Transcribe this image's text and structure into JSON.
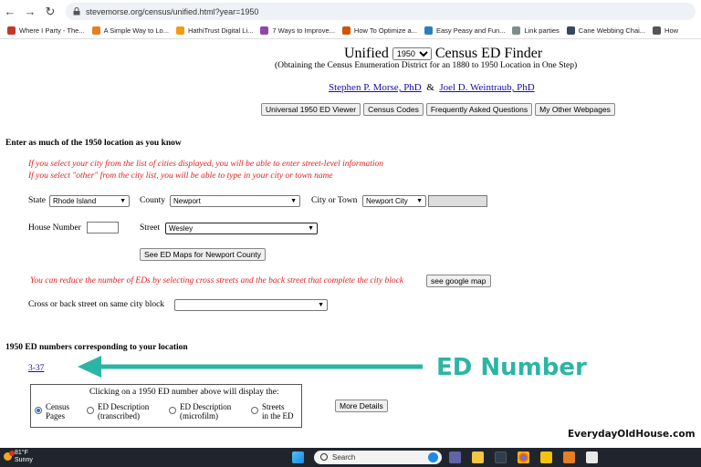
{
  "browser": {
    "url": "stevemorse.org/census/unified.html?year=1950",
    "bookmarks": [
      {
        "label": "Where I Party - The...",
        "color": "#c0392b"
      },
      {
        "label": "A Simple Way to Lo...",
        "color": "#e67e22"
      },
      {
        "label": "HathiTrust Digital Li...",
        "color": "#f39c12"
      },
      {
        "label": "7 Ways to Improve...",
        "color": "#8e44ad"
      },
      {
        "label": "How To Optimize a...",
        "color": "#d35400"
      },
      {
        "label": "Easy Peasy and Fun...",
        "color": "#2980b9"
      },
      {
        "label": "Link parties",
        "color": "#7f8c8d"
      },
      {
        "label": "Cane Webbing Chai...",
        "color": "#34495e"
      },
      {
        "label": "How",
        "color": "#555555"
      }
    ]
  },
  "header": {
    "title_prefix": "Unified",
    "year_selected": "1950",
    "title_suffix": "Census ED Finder",
    "subtitle": "(Obtaining the Census Enumeration District for an 1880 to 1950 Location in One Step)",
    "author1": "Stephen P. Morse, PhD",
    "amp": "&",
    "author2": "Joel D. Weintraub, PhD",
    "buttons": [
      "Universal 1950 ED Viewer",
      "Census Codes",
      "Frequently Asked Questions",
      "My Other Webpages"
    ]
  },
  "form": {
    "heading": "Enter as much of the 1950 location as you know",
    "note1": "If you select your city from the list of cities displayed, you will be able to enter street-level information",
    "note2": "If you select \"other\" from the city list, you will be able to type in your city or town name",
    "state_label": "State",
    "state_value": "Rhode Island",
    "county_label": "County",
    "county_value": "Newport",
    "city_label": "City or Town",
    "city_value": "Newport City",
    "house_label": "House Number",
    "house_value": "",
    "street_label": "Street",
    "street_value": "Wesley",
    "see_maps_button": "See ED Maps for Newport County",
    "cross_note": "You can reduce the number of EDs by selecting cross streets and the back street that complete the city block",
    "google_map_button": "see google map",
    "cross_label": "Cross or back street on same city block",
    "cross_value": ""
  },
  "results": {
    "heading": "1950 ED numbers corresponding to your location",
    "ed_number": "3-37",
    "caption": "Clicking on a 1950 ED number above will display the:",
    "options": [
      {
        "line1": "Census",
        "line2": "Pages",
        "selected": true
      },
      {
        "line1": "ED Description",
        "line2": "(transcribed)",
        "selected": false
      },
      {
        "line1": "ED Description",
        "line2": "(microfilm)",
        "selected": false
      },
      {
        "line1": "Streets",
        "line2": "in the ED",
        "selected": false
      }
    ],
    "more_details_button": "More Details"
  },
  "annotation": {
    "label": "ED Number",
    "color": "#2bb5a5",
    "watermark": "EverydayOldHouse.com"
  },
  "taskbar": {
    "temperature": "81°F",
    "condition": "Sunny",
    "search_placeholder": "Search"
  }
}
